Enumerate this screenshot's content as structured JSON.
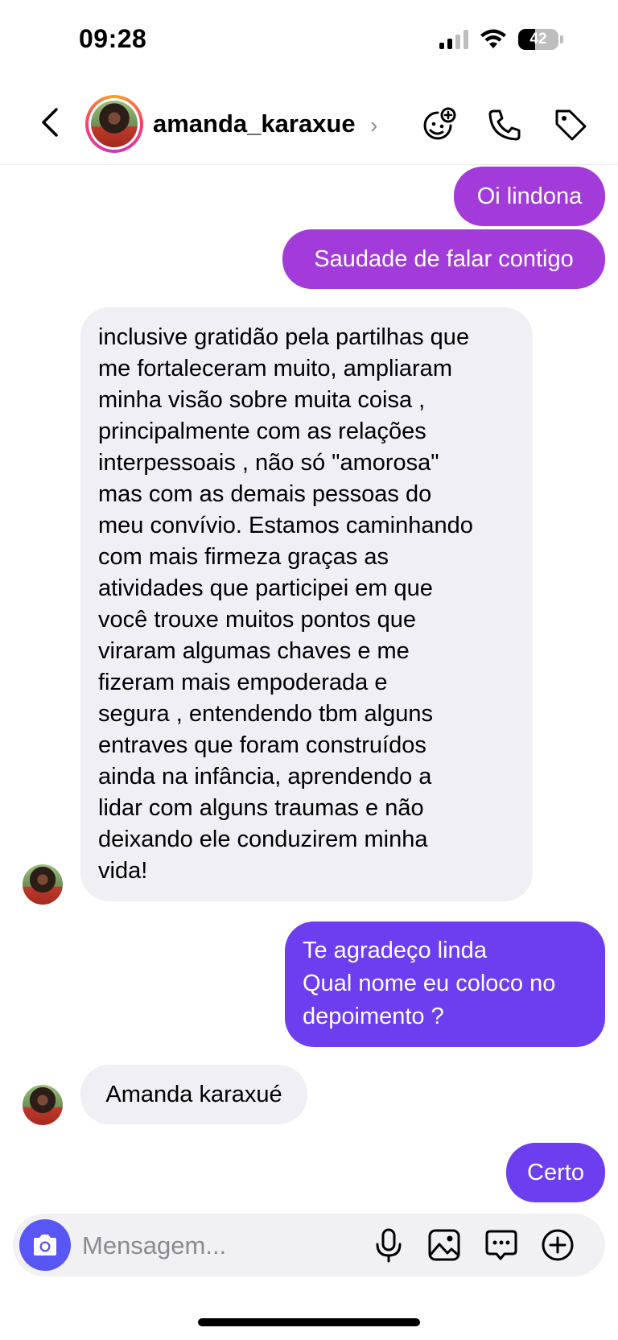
{
  "status": {
    "time": "09:28",
    "battery": "42"
  },
  "header": {
    "username": "amanda_karaxue",
    "chevron": "›"
  },
  "messages": [
    {
      "from": "me",
      "text": "Oi lindona"
    },
    {
      "from": "me",
      "text": "Saudade de falar contigo"
    },
    {
      "from": "them",
      "lines": [
        "inclusive gratidão pela partilhas que",
        "me fortaleceram muito, ampliaram",
        "minha visão sobre muita coisa ,",
        "principalmente com as relações",
        "interpessoais , não só \"amorosa\"",
        "mas com as demais pessoas do",
        "meu convívio. Estamos caminhando",
        "com mais firmeza graças as",
        "atividades que participei em que",
        "você trouxe muitos pontos que",
        "viraram algumas chaves e me",
        "fizeram mais empoderada e",
        "segura , entendendo tbm alguns",
        "entraves que foram construídos",
        "ainda na infância, aprendendo a",
        "lidar com alguns traumas e não",
        "deixando ele conduzirem minha",
        "vida!"
      ]
    },
    {
      "from": "me",
      "lines": [
        "Te agradeço linda",
        "Qual nome eu coloco no",
        "depoimento ?"
      ]
    },
    {
      "from": "them",
      "text": "Amanda karaxué"
    },
    {
      "from": "me",
      "text": "Certo"
    }
  ],
  "composer": {
    "placeholder": "Mensagem..."
  },
  "icons": {
    "back": "chevron-left-icon",
    "games": "game-sticker-icon",
    "call": "phone-icon",
    "tag": "tag-icon",
    "camera": "camera-icon",
    "mic": "microphone-icon",
    "gallery": "image-icon",
    "sticker": "chat-sticker-icon",
    "plus": "plus-circle-icon"
  },
  "colors": {
    "sent_purple": "#a23bd9",
    "sent_violet": "#6c3ef0",
    "received": "#efeff4",
    "camera": "#5856f4"
  }
}
